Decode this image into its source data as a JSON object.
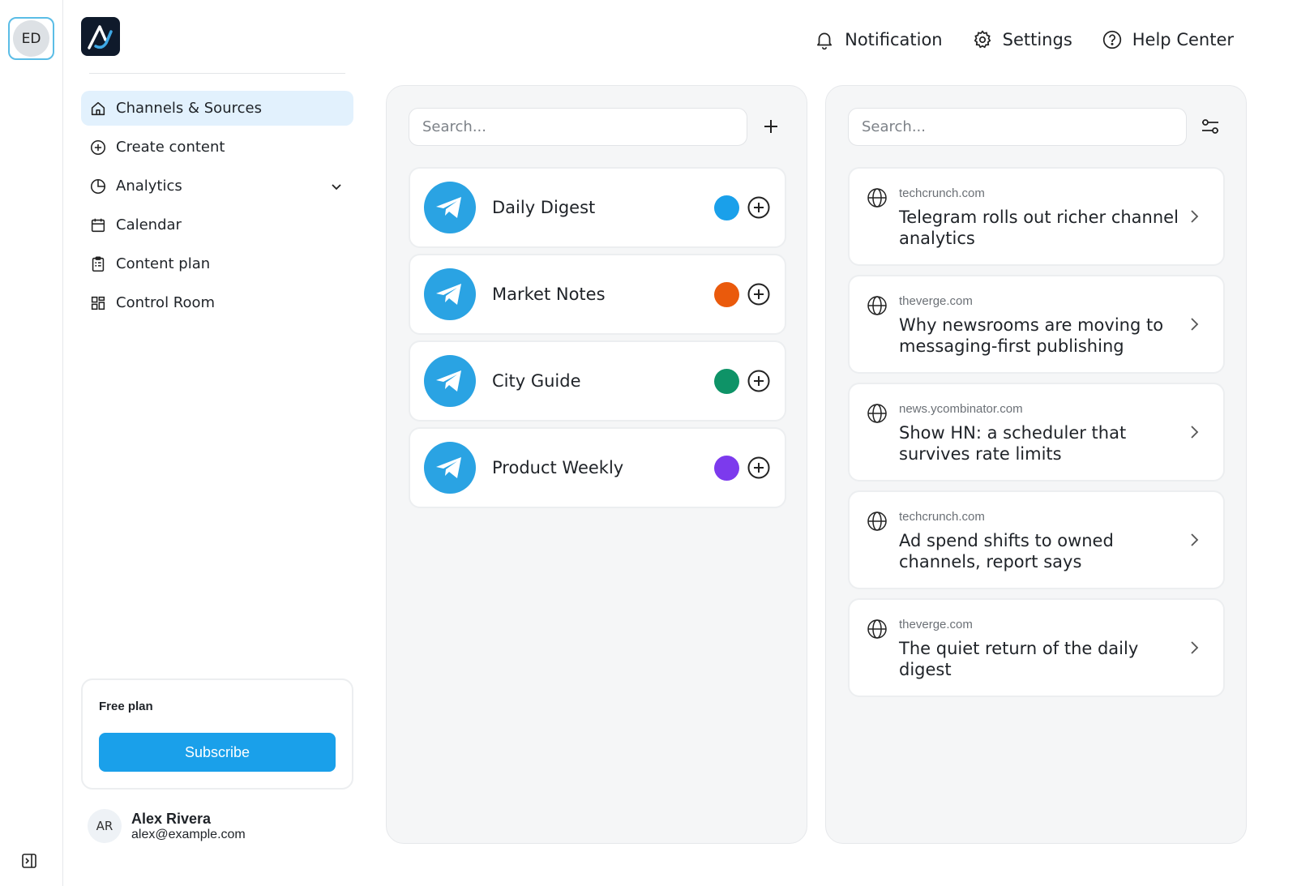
{
  "workspace": {
    "initials": "ED"
  },
  "nav": {
    "items": [
      {
        "label": "Channels & Sources",
        "icon": "home-icon",
        "active": true
      },
      {
        "label": "Create content",
        "icon": "plus-circle-icon"
      },
      {
        "label": "Analytics",
        "icon": "pie-chart-icon",
        "expandable": true
      },
      {
        "label": "Calendar",
        "icon": "calendar-icon"
      },
      {
        "label": "Content plan",
        "icon": "clipboard-icon"
      },
      {
        "label": "Control Room",
        "icon": "dashboard-icon"
      }
    ]
  },
  "plan": {
    "title": "Free plan",
    "button": "Subscribe"
  },
  "user": {
    "initials": "AR",
    "name": "Alex Rivera",
    "email": "alex@example.com"
  },
  "header": {
    "notification": "Notification",
    "settings": "Settings",
    "help": "Help Center"
  },
  "channels_panel": {
    "search_placeholder": "Search...",
    "channels": [
      {
        "name": "Daily Digest",
        "color": "#1aa0ea"
      },
      {
        "name": "Market Notes",
        "color": "#ea5a0c"
      },
      {
        "name": "City Guide",
        "color": "#0e9367"
      },
      {
        "name": "Product Weekly",
        "color": "#7c3aed"
      }
    ]
  },
  "sources_panel": {
    "search_placeholder": "Search...",
    "articles": [
      {
        "source": "techcrunch.com",
        "headline": "Telegram rolls out richer channel analytics"
      },
      {
        "source": "theverge.com",
        "headline": "Why newsrooms are moving to messaging-first publishing"
      },
      {
        "source": "news.ycombinator.com",
        "headline": "Show HN: a scheduler that survives rate limits"
      },
      {
        "source": "techcrunch.com",
        "headline": "Ad spend shifts to owned channels, report says"
      },
      {
        "source": "theverge.com",
        "headline": "The quiet return of the daily digest"
      }
    ]
  },
  "colors": {
    "accent": "#1aa0ea",
    "active_nav_bg": "#e2f1fd",
    "telegram": "#2aa3e3"
  }
}
